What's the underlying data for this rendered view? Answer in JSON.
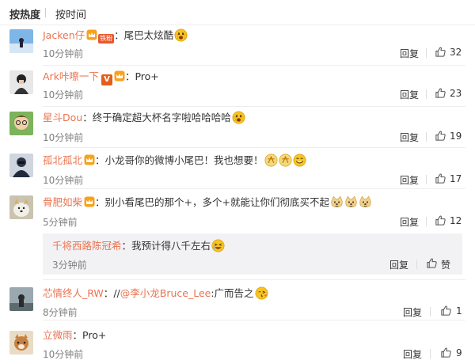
{
  "sort": {
    "hot": "按热度",
    "time": "按时间"
  },
  "reply_label": "回复",
  "comments": [
    {
      "user": "Jacken仔",
      "tag": "铁粉",
      "sep": "：",
      "text": "尾巴太炫酷",
      "time": "10分钟前",
      "likes": "32"
    },
    {
      "user": "Ark咔嚓一下",
      "sep": "：",
      "text": "Pro+",
      "time": "10分钟前",
      "likes": "23"
    },
    {
      "user": "星斗Dou",
      "sep": "：",
      "text": "终于确定超大杯名字啦哈哈哈哈",
      "time": "10分钟前",
      "likes": "19"
    },
    {
      "user": "孤北孤北",
      "sep": "：",
      "text": "小龙哥你的微博小尾巴！我也想要！",
      "time": "10分钟前",
      "likes": "17"
    },
    {
      "user": "骨肥如柴",
      "sep": "：",
      "text": "别小看尾巴的那个+，多个+就能让你们彻底买不起",
      "time": "5分钟前",
      "likes": "12"
    },
    {
      "user": "芯情终人_RW",
      "sep": "：",
      "text_pre": "//",
      "mention": "@李小龙Bruce_Lee",
      "text": ":广而告之",
      "time": "8分钟前",
      "likes": "1"
    },
    {
      "user": "立微雨",
      "sep": "：",
      "text": "Pro+",
      "time": "10分钟前",
      "likes": "9"
    }
  ],
  "subreply": {
    "user": "千将西路陈冠希",
    "sep": "：",
    "text": "我预计得八千左右",
    "time": "3分钟前",
    "like_label": "赞"
  },
  "icons": {
    "like": "thumbs-up-icon",
    "verified": "v-badge-icon",
    "member": "crown-badge-icon"
  },
  "colors": {
    "username": "#eb7350",
    "time": "#808080",
    "reply_bg": "#f2f2f5"
  }
}
